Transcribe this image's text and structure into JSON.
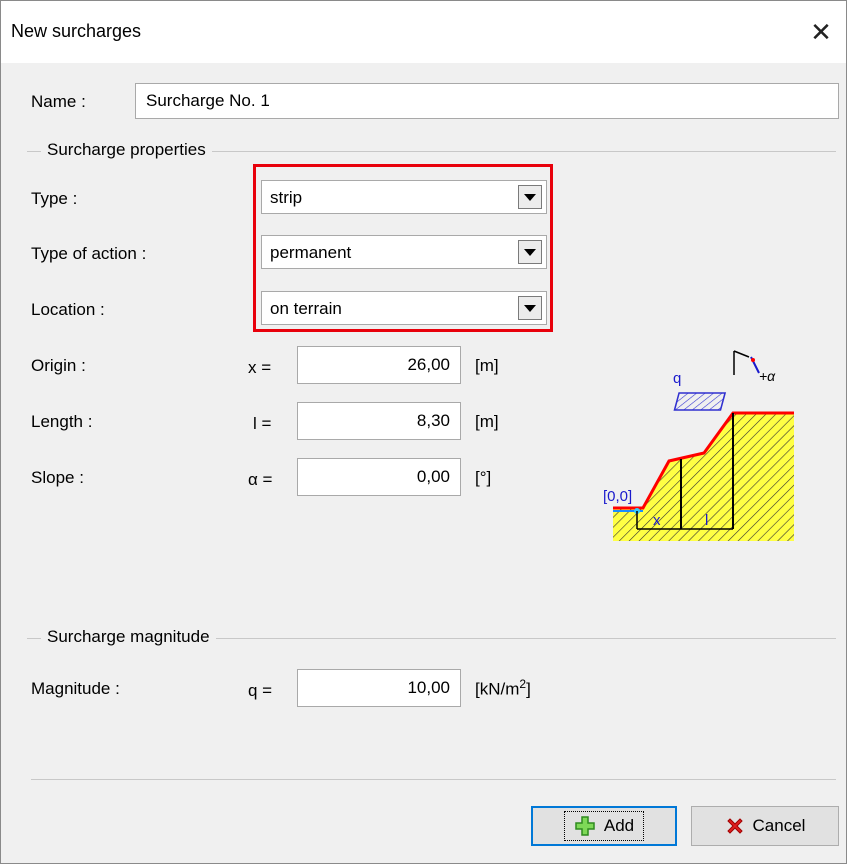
{
  "window": {
    "title": "New surcharges"
  },
  "name": {
    "label": "Name :",
    "value": "Surcharge No. 1"
  },
  "properties": {
    "group_title": "Surcharge properties",
    "type": {
      "label": "Type :",
      "value": "strip"
    },
    "action": {
      "label": "Type of action :",
      "value": "permanent"
    },
    "location": {
      "label": "Location :",
      "value": "on terrain"
    },
    "origin": {
      "label": "Origin :",
      "symbol": "x =",
      "value": "26,00",
      "unit": "[m]"
    },
    "length": {
      "label": "Length :",
      "symbol": "l =",
      "value": "8,30",
      "unit": "[m]"
    },
    "slope": {
      "label": "Slope :",
      "symbol": "α =",
      "value": "0,00",
      "unit": "[°]"
    }
  },
  "diagram": {
    "q_label": "q",
    "alpha_label": "+α",
    "origin_label": "[0,0]",
    "x_label": "x",
    "l_label": "l",
    "colors": {
      "terrain_line": "#ff0000",
      "soil": "#ffff44",
      "hatch": "#3030d0",
      "text": "#1a1acc"
    }
  },
  "magnitude": {
    "group_title": "Surcharge magnitude",
    "label": "Magnitude :",
    "symbol": "q =",
    "value": "10,00",
    "unit_base": "[kN/m",
    "unit_exp": "2",
    "unit_end": "]"
  },
  "buttons": {
    "add": "Add",
    "cancel": "Cancel"
  },
  "colors": {
    "highlight": "#e8000b",
    "accent": "#0078d7"
  }
}
